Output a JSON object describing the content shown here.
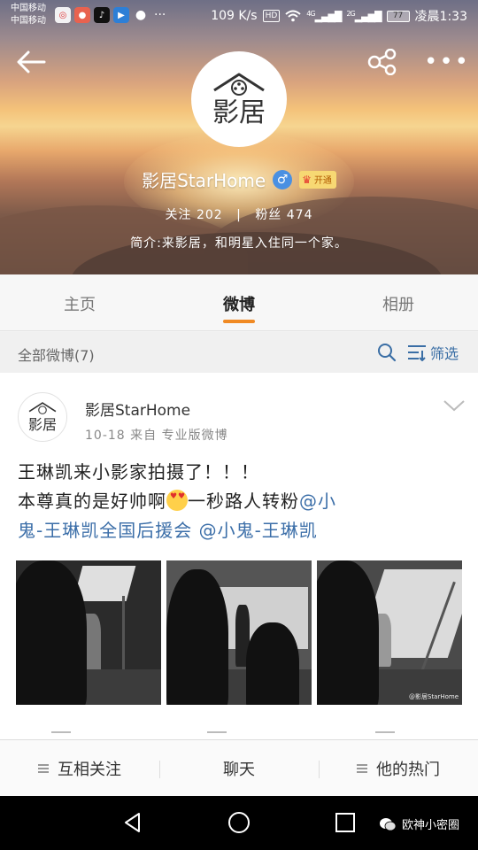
{
  "status_bar": {
    "carrier_1": "中国移动",
    "carrier_2": "中国移动",
    "net_speed": "109 K/s",
    "hd": "HD",
    "signal_1": "4G",
    "signal_2": "2G",
    "battery": "77",
    "time": "凌晨1:33"
  },
  "profile": {
    "logo_text": "影居",
    "name": "影居StarHome",
    "gender": "♂",
    "vip_label": "开通",
    "following_label": "关注",
    "following_count": "202",
    "separator": "|",
    "followers_label": "粉丝",
    "followers_count": "474",
    "bio": "简介:来影居，和明星入住同一个家。"
  },
  "tabs": [
    {
      "label": "主页"
    },
    {
      "label": "微博"
    },
    {
      "label": "相册"
    }
  ],
  "filter": {
    "count_label": "全部微博(7)",
    "filter_label": "筛选"
  },
  "post": {
    "author": "影居StarHome",
    "meta": "10-18  来自  专业版微博",
    "line1": "王琳凯来小影家拍摄了！！！",
    "line2_a": "本尊真的是好帅啊",
    "line2_b": "一秒路人转粉",
    "mention1_a": "@小",
    "mention1_b": "鬼-王琳凯全国后援会",
    "mention2": "@小鬼-王琳凯",
    "watermark": "@影居StarHome"
  },
  "bottom_bar": {
    "item1": "互相关注",
    "item2": "聊天",
    "item3": "他的热门"
  },
  "watermark_brand": "欧神小密圈"
}
